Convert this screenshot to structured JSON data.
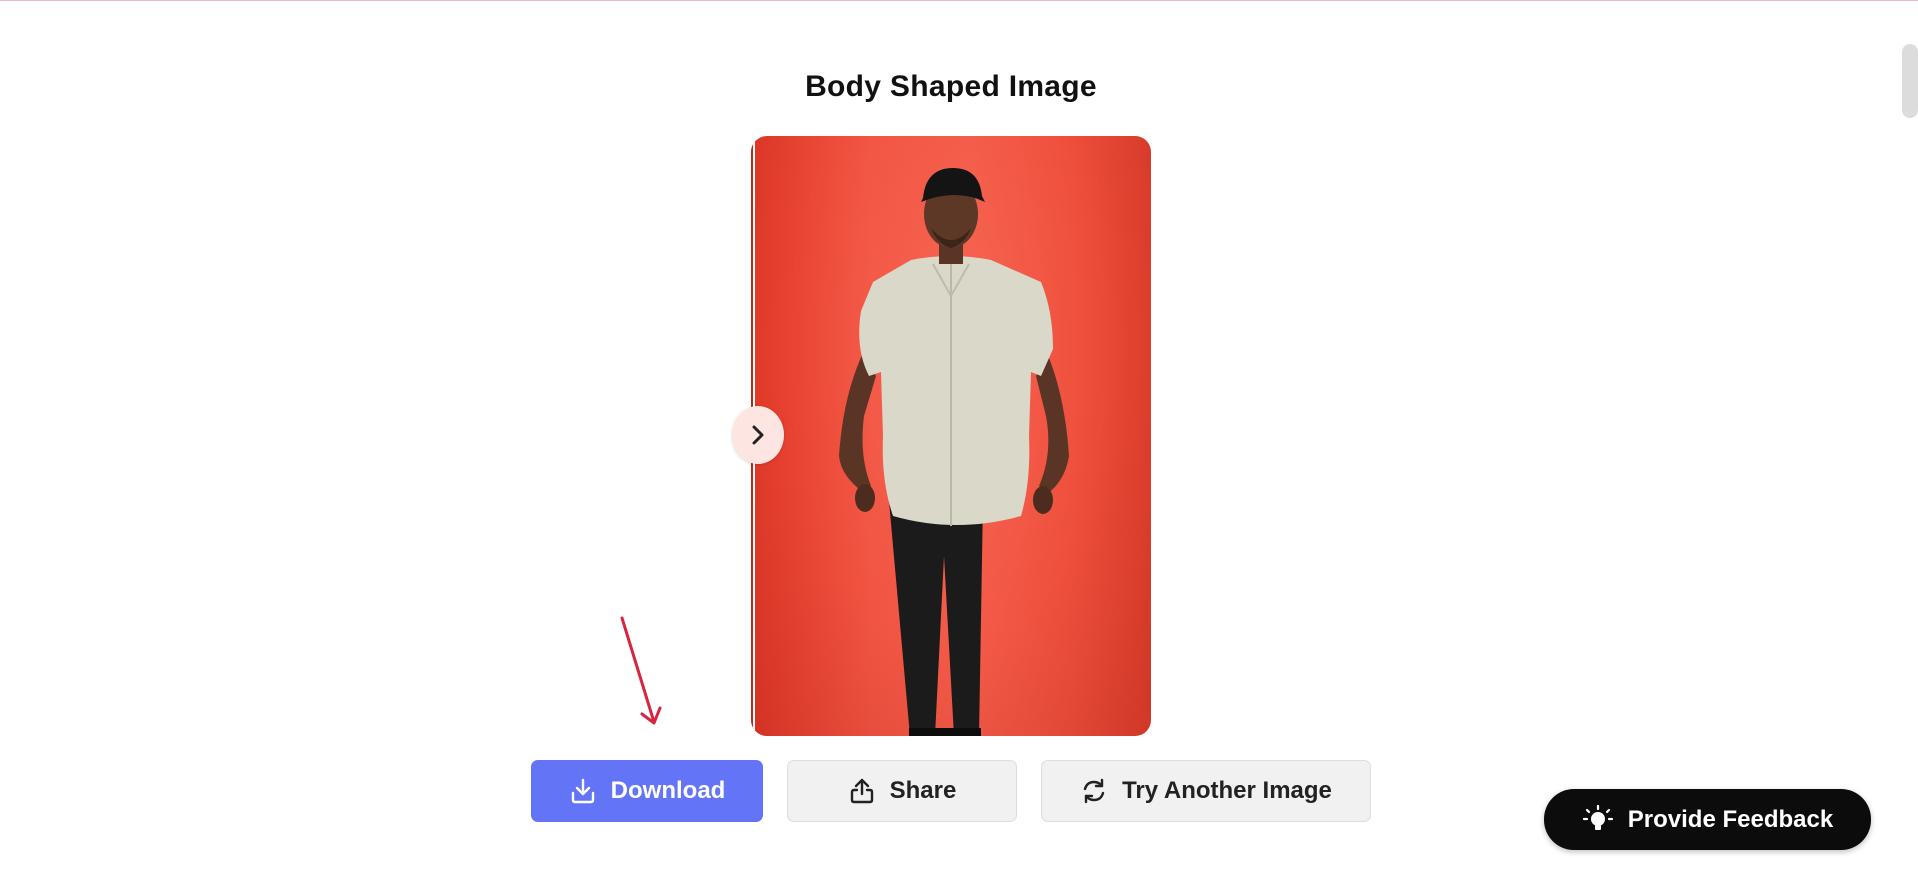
{
  "page": {
    "title": "Body Shaped Image"
  },
  "comparison": {
    "icons": {
      "slider": "chevron-right-icon"
    },
    "colors": {
      "background": "#f04e3d"
    }
  },
  "actions": {
    "download_label": "Download",
    "share_label": "Share",
    "try_another_label": "Try Another Image",
    "icons": {
      "download": "download-icon",
      "share": "share-icon",
      "try_another": "refresh-icon"
    },
    "colors": {
      "download_bg": "#6474f7",
      "secondary_bg": "#f1f1f1"
    }
  },
  "feedback": {
    "label": "Provide Feedback",
    "icon": "lightbulb-icon",
    "color": "#0c0c0c"
  },
  "annotation": {
    "icon": "arrow-down-icon",
    "color": "#d6263f"
  }
}
